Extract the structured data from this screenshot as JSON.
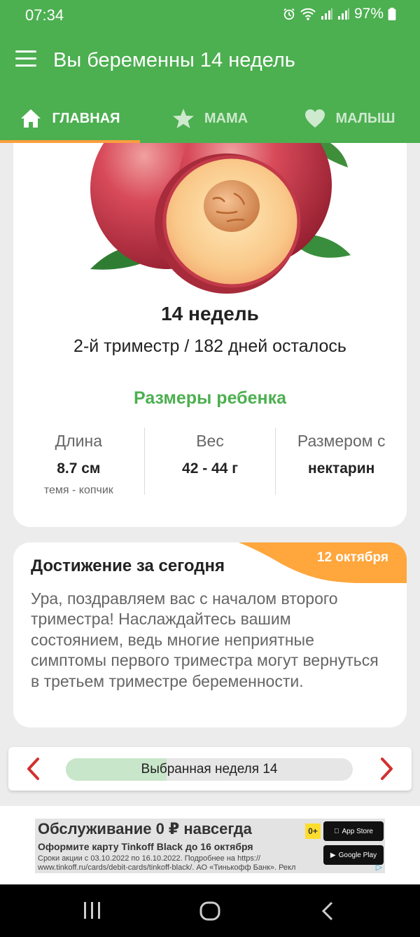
{
  "status": {
    "time": "07:34",
    "battery": "97%",
    "icons": [
      "alarm-icon",
      "wifi-icon",
      "signal-icon",
      "signal-icon",
      "battery-icon"
    ]
  },
  "appbar": {
    "title": "Вы беременны 14 недель",
    "menu_icon": "hamburger-menu-icon"
  },
  "tabs": [
    {
      "label": "ГЛАВНАЯ",
      "icon": "home-icon",
      "active": true
    },
    {
      "label": "МАМА",
      "icon": "star-icon",
      "active": false
    },
    {
      "label": "МАЛЫШ",
      "icon": "heart-icon",
      "active": false
    }
  ],
  "summary": {
    "week": "14 недель",
    "trimester_line": "2-й триместр / 182 дней осталось",
    "sizes_title": "Размеры ребенка",
    "fruit_image": "nectarine-image",
    "metrics": [
      {
        "label": "Длина",
        "value": "8.7 см",
        "sub": "темя - копчик"
      },
      {
        "label": "Вес",
        "value": "42 - 44 г",
        "sub": ""
      },
      {
        "label": "Размером с",
        "value": "нектарин",
        "sub": ""
      }
    ]
  },
  "achievement": {
    "title": "Достижение за сегодня",
    "date": "12 октября",
    "body": "Ура, поздравляем вас с началом второго триместра! Наслаждайтесь вашим состоянием, ведь многие неприятные симптомы первого триместра могут вернуться в третьем триместре беременности."
  },
  "week_selector": {
    "label": "Выбранная неделя 14",
    "progress": 0.35
  },
  "ad": {
    "headline": "Обслуживание 0 ₽ навсегда",
    "subline": "Оформите карту Tinkoff Black до 16 октября",
    "small": "Сроки акции с 03.10.2022 по 16.10.2022. Подробнее на https:// www.tinkoff.ru/cards/debit-cards/tinkoff-black/. АО «Тинькофф Банк». Рекл",
    "age": "0+",
    "store1": "App Store",
    "store2": "Google Play"
  },
  "colors": {
    "primary": "#4caf50",
    "accent": "#ff9e3d",
    "arrow": "#d32f2f",
    "week_fill": "#c8e6c9"
  }
}
